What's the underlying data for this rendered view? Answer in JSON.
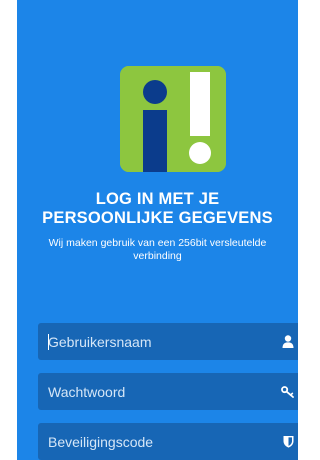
{
  "login": {
    "heading_line1": "LOG IN MET JE",
    "heading_line2": "PERSOONLIJKE GEGEVENS",
    "subtitle": "Wij maken gebruik van een 256bit versleutelde verbinding"
  },
  "fields": {
    "username": {
      "placeholder": "Gebruikersnaam",
      "icon": "person-icon"
    },
    "password": {
      "placeholder": "Wachtwoord",
      "icon": "key-icon"
    },
    "security_code": {
      "placeholder": "Beveiligingscode",
      "icon": "shield-icon"
    }
  },
  "colors": {
    "background": "#1c85e8",
    "field_background": "#1766b5",
    "logo_green": "#8dc63f",
    "logo_navy": "#0b3c8c"
  }
}
